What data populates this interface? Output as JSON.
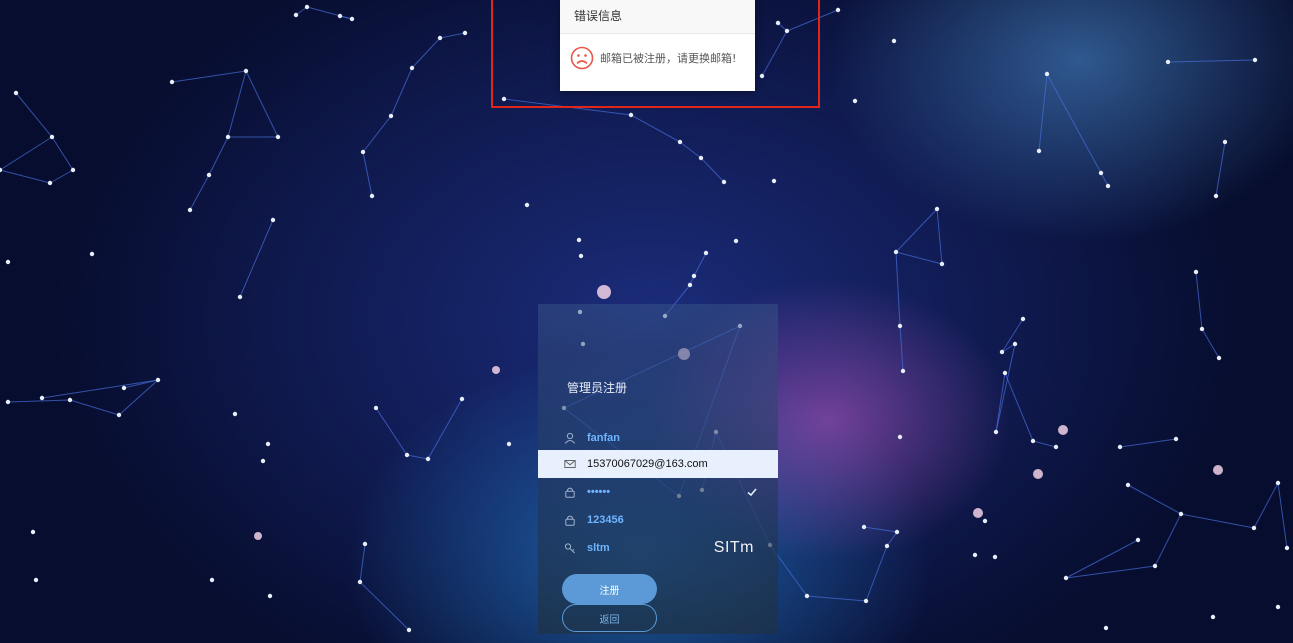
{
  "error_dialog": {
    "title": "错误信息",
    "icon": "sad-face-icon",
    "message": "邮箱已被注册，请更换邮箱!"
  },
  "register_form": {
    "title": "管理员注册",
    "fields": [
      {
        "name": "username",
        "icon": "user-icon",
        "value": "fanfan"
      },
      {
        "name": "email",
        "icon": "mail-icon",
        "value": "15370067029@163.com"
      },
      {
        "name": "password",
        "icon": "lock-icon",
        "value": "••••••"
      },
      {
        "name": "confirm_password",
        "icon": "lock-icon",
        "value": "123456"
      },
      {
        "name": "captcha",
        "icon": "key-icon",
        "value": "sltm",
        "captcha_image_text": "SITm"
      }
    ],
    "register_label": "注册",
    "back_label": "返回"
  },
  "colors": {
    "accent": "#5b9ad6",
    "error_highlight": "#e0261b",
    "field_text": "#6fb4ff"
  }
}
